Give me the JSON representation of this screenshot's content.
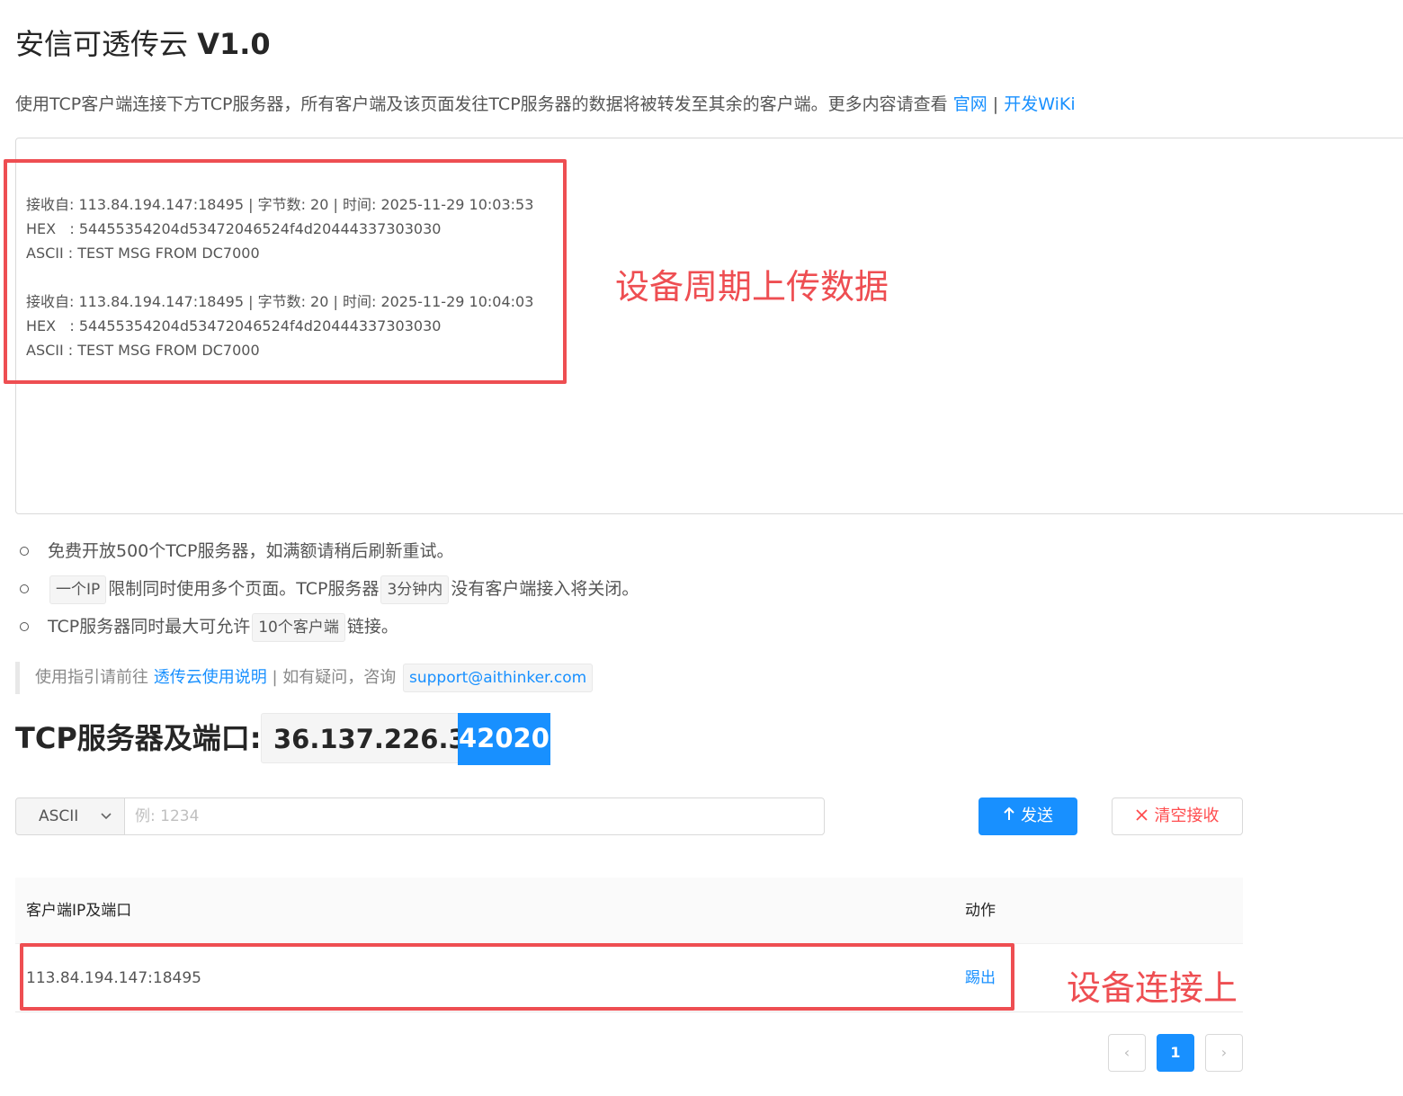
{
  "header": {
    "title_main": "安信可透传云",
    "title_version": "V1.0",
    "description": "使用TCP客户端连接下方TCP服务器，所有客户端及该页面发往TCP服务器的数据将被转发至其余的客户端。更多内容请查看",
    "link_official": "官网",
    "link_separator": "|",
    "link_wiki": "开发WiKi"
  },
  "received": {
    "messages": [
      {
        "meta": "接收自: 113.84.194.147:18495 | 字节数: 20 | 时间: 2025-11-29 10:03:53",
        "hex": "HEX   : 54455354204d53472046524f4d20444337303030",
        "ascii": "ASCII : TEST MSG FROM DC7000"
      },
      {
        "meta": "接收自: 113.84.194.147:18495 | 字节数: 20 | 时间: 2025-11-29 10:04:03",
        "hex": "HEX   : 54455354204d53472046524f4d20444337303030",
        "ascii": "ASCII : TEST MSG FROM DC7000"
      }
    ]
  },
  "annotations": {
    "upload": "设备周期上传数据",
    "connected": "设备连接上"
  },
  "notes": {
    "line1": "免费开放500个TCP服务器，如满额请稍后刷新重试。",
    "line2_code1": "一个IP",
    "line2_text1": "限制同时使用多个页面。TCP服务器",
    "line2_code2": "3分钟内",
    "line2_text2": "没有客户端接入将关闭。",
    "line3_text1": "TCP服务器同时最大可允许",
    "line3_code": "10个客户端",
    "line3_text2": "链接。"
  },
  "guide": {
    "prefix": "使用指引请前往",
    "link": "透传云使用说明",
    "middle": "| 如有疑问，咨询",
    "email": "support@aithinker.com"
  },
  "server": {
    "label": "TCP服务器及端口:",
    "ip": "36.137.226.30 :",
    "port": "42020"
  },
  "send": {
    "mode": "ASCII",
    "placeholder": "例: 1234",
    "send_label": "发送",
    "clear_label": "清空接收"
  },
  "clients": {
    "columns": [
      "客户端IP及端口",
      "动作"
    ],
    "rows": [
      {
        "address": "113.84.194.147:18495",
        "action": "踢出"
      }
    ]
  },
  "pagination": {
    "prev": "‹",
    "current": "1",
    "next": "›"
  },
  "colors": {
    "accent": "#1890ff",
    "danger": "#ff4d4f",
    "annotation": "#ee4e52"
  }
}
